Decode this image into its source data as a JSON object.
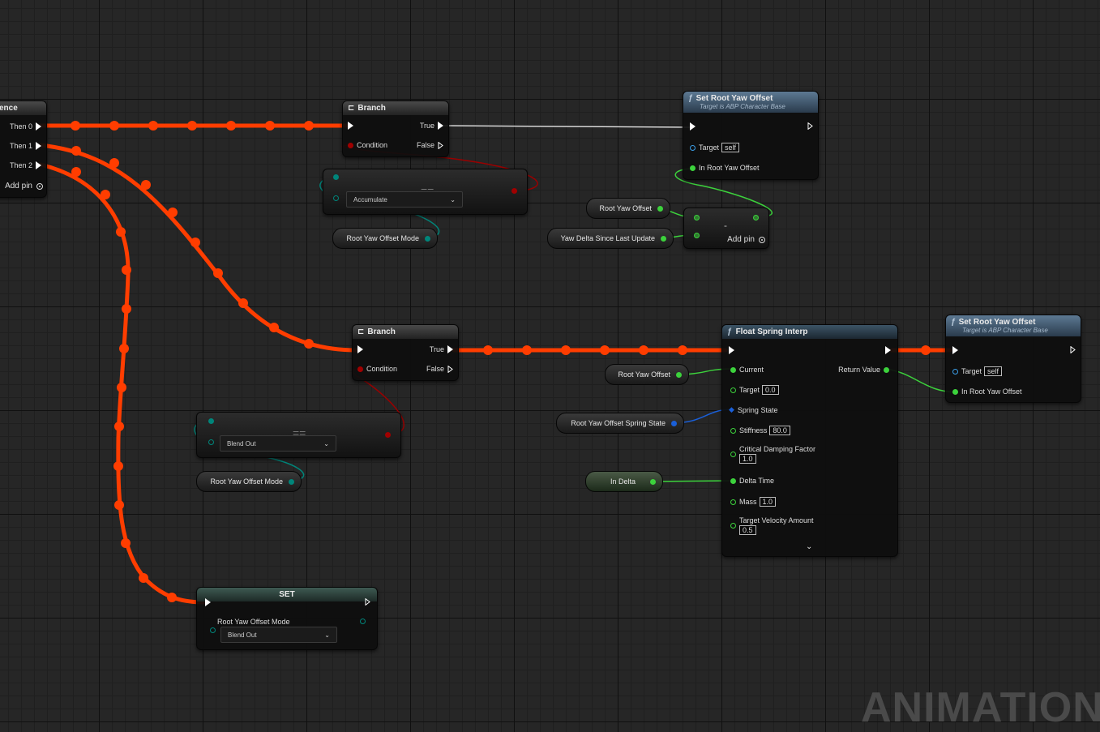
{
  "sequence": {
    "title_fragment": "ence",
    "then0": "Then 0",
    "then1": "Then 1",
    "then2": "Then 2",
    "add_pin": "Add pin"
  },
  "branch1": {
    "title": "Branch",
    "true_label": "True",
    "condition": "Condition",
    "false_label": "False"
  },
  "equal1": {
    "op": "==",
    "value": "Accumulate"
  },
  "var_mode1": "Root Yaw Offset Mode",
  "set_root1": {
    "title": "Set Root Yaw Offset",
    "subtitle": "Target is ABP Character Base",
    "target_label": "Target",
    "target_value": "self",
    "in_label": "In Root Yaw Offset"
  },
  "var_root_yaw": "Root Yaw Offset",
  "var_yaw_delta": "Yaw Delta Since Last Update",
  "subtract": {
    "op": "-",
    "add_pin": "Add pin"
  },
  "branch2": {
    "title": "Branch",
    "true_label": "True",
    "condition": "Condition",
    "false_label": "False"
  },
  "equal2": {
    "op": "==",
    "value": "Blend Out"
  },
  "var_mode2": "Root Yaw Offset Mode",
  "spring": {
    "title": "Float Spring Interp",
    "current": "Current",
    "target": "Target",
    "target_value": "0.0",
    "spring_state": "Spring State",
    "stiffness": "Stiffness",
    "stiffness_value": "80.0",
    "critical": "Critical Damping Factor",
    "critical_value": "1.0",
    "delta_time": "Delta Time",
    "mass": "Mass",
    "mass_value": "1.0",
    "tva": "Target Velocity Amount",
    "tva_value": "0.5",
    "return_value": "Return Value"
  },
  "var_root_yaw2": "Root Yaw Offset",
  "var_spring_state": "Root Yaw Offset Spring State",
  "var_in_delta": "In Delta",
  "set_root2": {
    "title": "Set Root Yaw Offset",
    "subtitle": "Target is ABP Character Base",
    "target_label": "Target",
    "target_value": "self",
    "in_label": "In Root Yaw Offset"
  },
  "set_node": {
    "title": "SET",
    "label": "Root Yaw Offset Mode",
    "value": "Blend Out"
  },
  "watermark": "ANIMATION",
  "colors": {
    "exec_wire": "#ff3d00",
    "float_pin": "#3cd23c",
    "bool_pin": "#a00000",
    "enum_pin": "#00857a",
    "object_pin": "#3a9ee8",
    "struct_pin": "#1a5fd8"
  }
}
